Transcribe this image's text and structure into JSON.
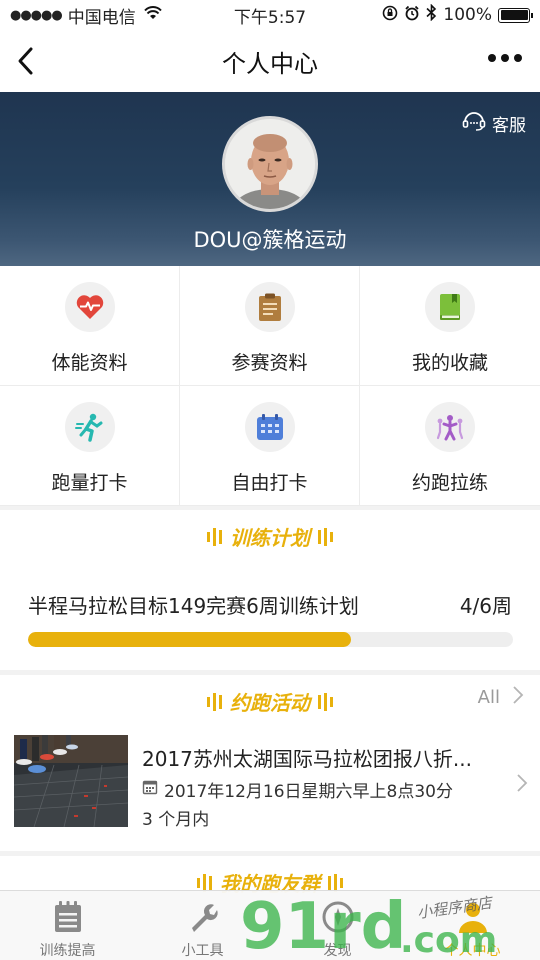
{
  "status_bar": {
    "carrier": "中国电信",
    "time": "下午5:57",
    "battery": "100%",
    "battery_level": 1.0
  },
  "navbar": {
    "title": "个人中心",
    "back_icon": "back-chevron-icon",
    "more_icon": "more-dots-icon"
  },
  "profile": {
    "service_label": "客服",
    "username": "DOU@簇格运动"
  },
  "grid": {
    "items": [
      {
        "label": "体能资料",
        "icon": "heart-pulse-icon",
        "color": "#e2463b"
      },
      {
        "label": "参赛资料",
        "icon": "clipboard-icon",
        "color": "#b07d3e"
      },
      {
        "label": "我的收藏",
        "icon": "book-icon",
        "color": "#7cbf3a"
      },
      {
        "label": "跑量打卡",
        "icon": "runner-icon",
        "color": "#26b8b0"
      },
      {
        "label": "自由打卡",
        "icon": "calendar-icon",
        "color": "#4f7fd9"
      },
      {
        "label": "约跑拉练",
        "icon": "group-run-icon",
        "color": "#a35cc7"
      }
    ]
  },
  "training_plan": {
    "heading": "训练计划",
    "name": "半程马拉松目标149完赛6周训练计划",
    "weeks": "4/6周",
    "progress": 0.667,
    "accent": "#e8b10c"
  },
  "activity": {
    "heading": "约跑活动",
    "all_label": "All",
    "event": {
      "title": "2017苏州太湖国际马拉松团报八折...",
      "date": "2017年12月16日星期六早上8点30分",
      "when": "3 个月内"
    }
  },
  "group": {
    "heading": "我的跑友群"
  },
  "tabbar": {
    "tabs": [
      {
        "label": "训练提高",
        "icon": "notepad-icon",
        "active": false
      },
      {
        "label": "小工具",
        "icon": "wrench-icon",
        "active": false
      },
      {
        "label": "发现",
        "icon": "compass-icon",
        "active": false
      },
      {
        "label": "个人中心",
        "icon": "person-icon",
        "active": true
      }
    ]
  },
  "watermark": {
    "big": "91rd",
    "com": ".com",
    "small": "小程序商店"
  }
}
